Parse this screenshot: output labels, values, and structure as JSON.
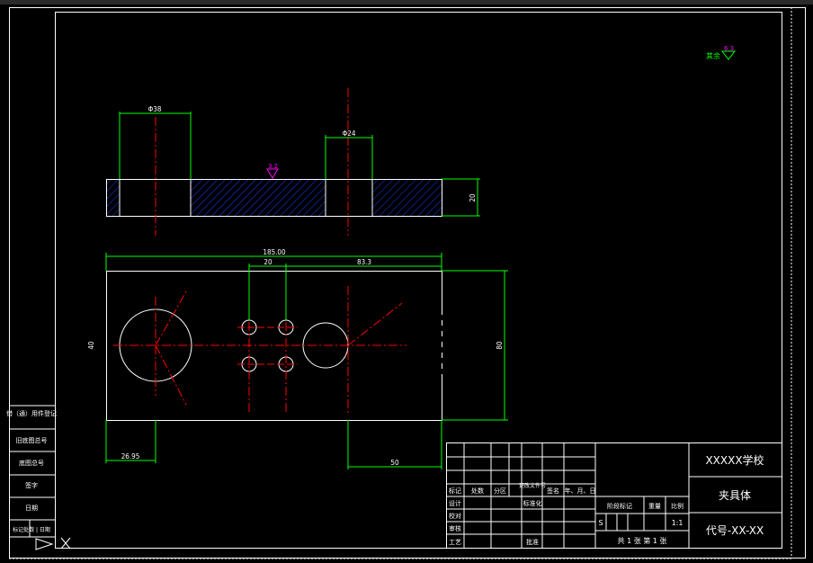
{
  "colors": {
    "background": "#000000",
    "outline": "#ffffff",
    "dimension": "#00ff00",
    "centerline": "#ff0000",
    "hatch": "#1e3cff",
    "surface_symbol": "#ff00ff"
  },
  "roughness": {
    "general_label": "其余",
    "general_value": "6.3",
    "top_value": "3.2"
  },
  "dimensions": {
    "top_left": "Φ38",
    "top_right": "Φ24",
    "thickness": "20",
    "overall_length": "185.00",
    "hole_pitch": "20",
    "hole_to_bore": "83.3",
    "height": "80",
    "left_side": "40",
    "bottom_left": "26.95",
    "bottom_right": "50"
  },
  "side_table": {
    "rows": [
      "借（通）用件登记",
      "旧底图总号",
      "底图总号",
      "签字",
      "日期",
      "标记处数 | 日期"
    ]
  },
  "title_block": {
    "school": "XXXXX学校",
    "part_name": "夹具体",
    "code": "代号-XX-XX",
    "headers": [
      "标记",
      "处数",
      "分区",
      "更改文件号",
      "签名",
      "年、月、日"
    ],
    "rows_left": [
      "设计",
      "校对",
      "审核",
      "工艺"
    ],
    "standardize": "标准化",
    "approve": "批准",
    "stage_mark": "阶段标记",
    "weight": "重量",
    "scale_label": "比例",
    "scale_value": "1:1",
    "stage_s": "S",
    "sheets": "共 1 张  第 1 张"
  }
}
